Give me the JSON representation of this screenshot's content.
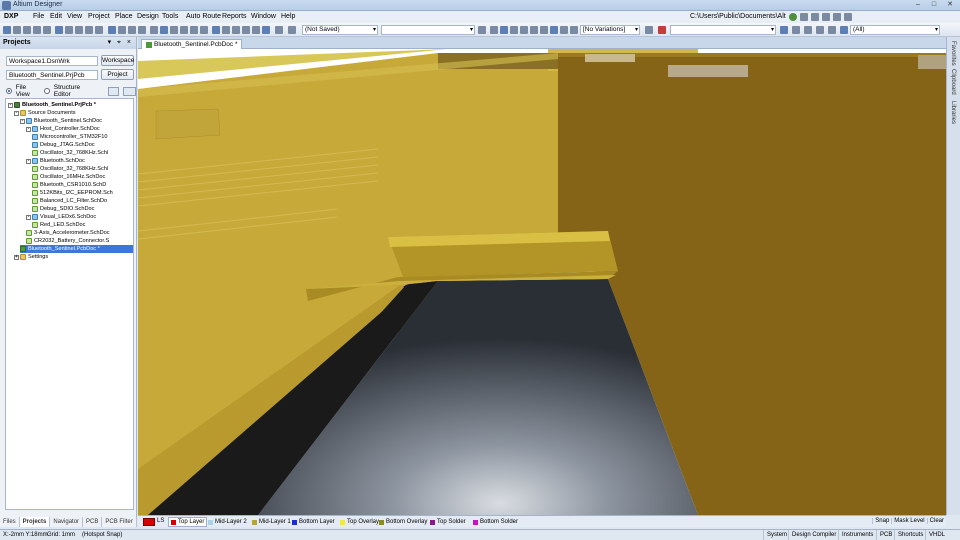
{
  "app": {
    "title": "Altium Designer"
  },
  "menu": {
    "items": [
      "DXP",
      "File",
      "Edit",
      "View",
      "Project",
      "Place",
      "Design",
      "Tools",
      "Auto Route",
      "Reports",
      "Window",
      "Help"
    ],
    "path": "C:\\Users\\Public\\Documents\\Altiur"
  },
  "toolbar": {
    "saved_state": "(Not Saved)",
    "variations": "[No Variations]",
    "filter": "(All)"
  },
  "projects": {
    "title": "Projects",
    "header_controls": "▾ ⌖ ×",
    "workspace_value": "Workspace1.DsnWrk",
    "workspace_button": "Workspace",
    "project_value": "Bluetooth_Sentinel.PrjPcb",
    "project_button": "Project",
    "view_file": "File View",
    "view_structure": "Structure Editor",
    "tree": [
      {
        "label": "Bluetooth_Sentinel.PrjPcb *",
        "level": 0,
        "icon": "prj",
        "bold": true,
        "expander": "-"
      },
      {
        "label": "Source Documents",
        "level": 1,
        "icon": "folder",
        "expander": "-"
      },
      {
        "label": "Bluetooth_Sentinel.SchDoc",
        "level": 2,
        "icon": "sch",
        "expander": "-"
      },
      {
        "label": "Host_Controller.SchDoc",
        "level": 3,
        "icon": "sch",
        "expander": "-"
      },
      {
        "label": "Microcontroller_STM32F10",
        "level": 4,
        "icon": "sch"
      },
      {
        "label": "Debug_JTAG.SchDoc",
        "level": 4,
        "icon": "sch"
      },
      {
        "label": "Oscillator_32_768KHz.Schl",
        "level": 4,
        "icon": "sch2"
      },
      {
        "label": "Bluetooth.SchDoc",
        "level": 3,
        "icon": "sch",
        "expander": "-"
      },
      {
        "label": "Oscillator_32_768KHz.Schl",
        "level": 4,
        "icon": "sch2"
      },
      {
        "label": "Oscillator_16MHz.SchDoc",
        "level": 4,
        "icon": "sch2"
      },
      {
        "label": "Bluetooth_CSR1010.SchD",
        "level": 4,
        "icon": "sch2"
      },
      {
        "label": "512KBits_I2C_EEPROM.Sch",
        "level": 4,
        "icon": "sch2"
      },
      {
        "label": "Balanced_LC_Filter.SchDo",
        "level": 4,
        "icon": "sch2"
      },
      {
        "label": "Debug_SDIO.SchDoc",
        "level": 4,
        "icon": "sch2"
      },
      {
        "label": "Visual_LEDx6.SchDoc",
        "level": 3,
        "icon": "sch",
        "expander": "-"
      },
      {
        "label": "Red_LED.SchDoc",
        "level": 4,
        "icon": "sch2"
      },
      {
        "label": "3-Axis_Accelerometer.SchDoc",
        "level": 3,
        "icon": "sch2"
      },
      {
        "label": "CR2032_Battery_Connector.S",
        "level": 3,
        "icon": "sch2"
      },
      {
        "label": "Bluetooth_Sentinel.PcbDoc *",
        "level": 2,
        "icon": "pcb",
        "selected": true
      },
      {
        "label": "Settings",
        "level": 1,
        "icon": "folder",
        "expander": "+"
      }
    ],
    "bottom_tabs": [
      "Files",
      "Projects",
      "Navigator",
      "PCB",
      "PCB Filter"
    ],
    "active_bottom_tab": "Projects"
  },
  "document": {
    "tab_label": "Bluetooth_Sentinel.PcbDoc *"
  },
  "side_panels": [
    "Favorites",
    "Clipboard",
    "Libraries"
  ],
  "layers": {
    "ls_label": "LS",
    "tabs": [
      {
        "label": "Top Layer",
        "color": "#d60000",
        "active": true
      },
      {
        "label": "Mid-Layer 2",
        "color": "#a9d3e8"
      },
      {
        "label": "Mid-Layer 1",
        "color": "#b5a33c"
      },
      {
        "label": "Bottom Layer",
        "color": "#1b2ccb"
      },
      {
        "label": "Top Overlay",
        "color": "#f2ea3a"
      },
      {
        "label": "Bottom Overlay",
        "color": "#8a8a2a"
      },
      {
        "label": "Top Solder",
        "color": "#8a1a8a"
      },
      {
        "label": "Bottom Solder",
        "color": "#c018c0"
      }
    ],
    "right_controls": [
      "Snap",
      "Mask Level",
      "Clear"
    ]
  },
  "status": {
    "coords": "X:-2mm Y:18mm",
    "grid": "Grid: 1mm",
    "snap": "(Hotspot Snap)",
    "right_items": [
      "System",
      "Design Compiler",
      "Instruments",
      "PCB",
      "Shortcuts",
      "VHDL"
    ]
  },
  "colors": {
    "board_copper": "#b8962e",
    "board_top": "#d8c248",
    "board_dark": "#1c1c1c",
    "cut_gray": "#9aa3ad"
  }
}
